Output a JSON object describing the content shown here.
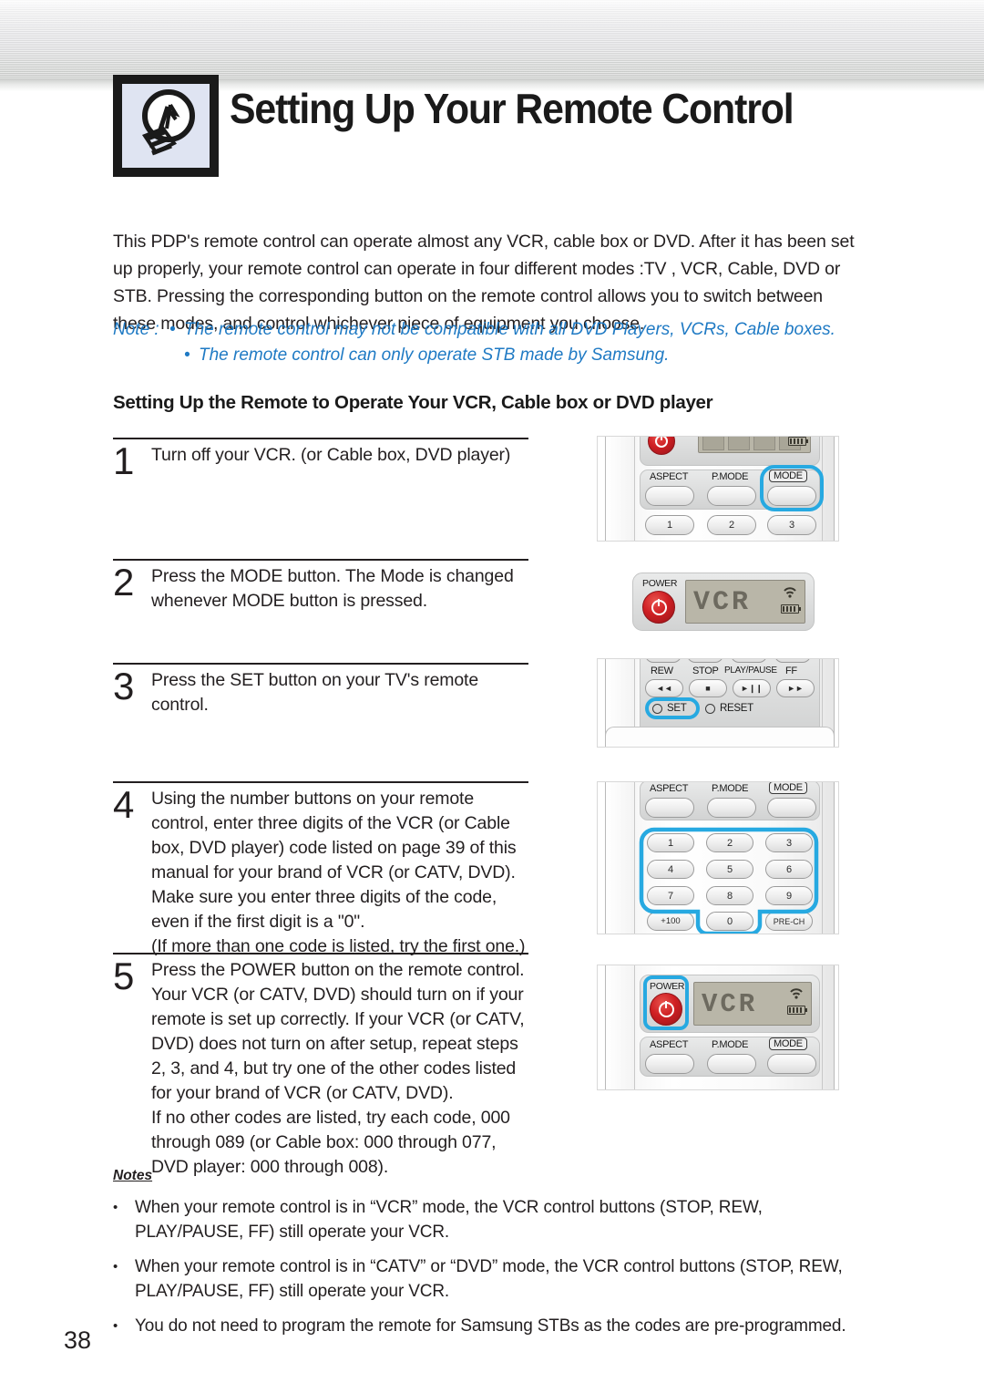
{
  "header": {
    "title": "Setting Up Your Remote Control",
    "icon": "lightbulb-icon"
  },
  "intro": {
    "paragraph": "This PDP's remote control can operate almost any VCR, cable box or DVD. After it has been set up properly, your remote control can operate in four different modes :TV , VCR, Cable, DVD or STB. Pressing the corresponding button on the remote control allows you to switch between these modes, and control whichever piece of equipment you choose."
  },
  "note": {
    "label": "Note :",
    "lines": [
      "The remote control may not be compatible with all DVD Players, VCRs, Cable boxes.",
      "The remote control can only operate STB made by Samsung."
    ]
  },
  "sub_heading": "Setting Up the Remote to Operate Your VCR, Cable box or DVD player",
  "steps": [
    {
      "number": "1",
      "text": "Turn off your VCR. (or Cable box, DVD player)"
    },
    {
      "number": "2",
      "text": "Press the MODE button. The Mode is changed whenever MODE button is pressed."
    },
    {
      "number": "3",
      "text": "Press the SET button on your TV's remote control."
    },
    {
      "number": "4",
      "text": "Using the number buttons on your remote control, enter three digits of the VCR (or Cable box, DVD player) code listed on page 39 of this manual for your brand of VCR (or CATV, DVD). Make sure you enter three digits of the code, even if the first digit is a \"0\".\n(If more than one code is listed, try the first one.)"
    },
    {
      "number": "5",
      "text": "Press the POWER button on the remote control. Your VCR (or CATV, DVD) should turn on if your remote is set up correctly. If your VCR (or CATV, DVD) does not turn on after setup, repeat steps 2, 3, and 4, but try one of the other codes listed for your brand of VCR (or CATV, DVD).\nIf no other codes are listed, try each code, 000 through 089 (or Cable box: 000 through 077, DVD player: 000 through 008)."
    }
  ],
  "notes": {
    "heading": "Notes",
    "bullet": "•",
    "items": [
      "When your remote control is in “VCR” mode, the VCR control buttons (STOP, REW, PLAY/PAUSE, FF) still operate your VCR.",
      "When your remote control is in “CATV” or “DVD” mode, the VCR control buttons (STOP, REW, PLAY/PAUSE, FF) still operate your VCR.",
      "You do not need to program the remote for Samsung STBs as the codes are pre-programmed."
    ]
  },
  "page_number": "38",
  "figures": {
    "fig1": {
      "name": "remote-top-with-mode-highlight",
      "labels": [
        "ASPECT",
        "P.MODE",
        "MODE"
      ],
      "number_row": [
        "1",
        "2",
        "3"
      ],
      "highlight": "MODE"
    },
    "fig2": {
      "name": "remote-display-vcr",
      "power_label": "POWER",
      "display_text": "VCR"
    },
    "fig3": {
      "name": "remote-transport-set-highlight",
      "transport_labels": [
        "REW",
        "STOP",
        "PLAY/PAUSE",
        "FF"
      ],
      "transport_glyphs": [
        "◄◄",
        "■",
        "►❙❙",
        "►►"
      ],
      "set_label": "SET",
      "reset_label": "RESET",
      "highlight": "SET"
    },
    "fig4": {
      "name": "remote-number-pad-highlight",
      "labels": [
        "ASPECT",
        "P.MODE",
        "MODE"
      ],
      "keys": [
        "1",
        "2",
        "3",
        "4",
        "5",
        "6",
        "7",
        "8",
        "9"
      ],
      "bottom_keys": [
        "+100",
        "0",
        "PRE-CH"
      ],
      "highlight": "number-keys-0-9"
    },
    "fig5": {
      "name": "remote-power-highlight-vcr-display",
      "power_label": "POWER",
      "display_text": "VCR",
      "labels": [
        "ASPECT",
        "P.MODE",
        "MODE"
      ],
      "highlight": "POWER"
    }
  },
  "colors": {
    "highlight": "#27a9e1",
    "note_text": "#1f7ac4",
    "body_text": "#231f20",
    "power_red": "#cf1f23",
    "lcd_bg": "#b9b6a8"
  }
}
